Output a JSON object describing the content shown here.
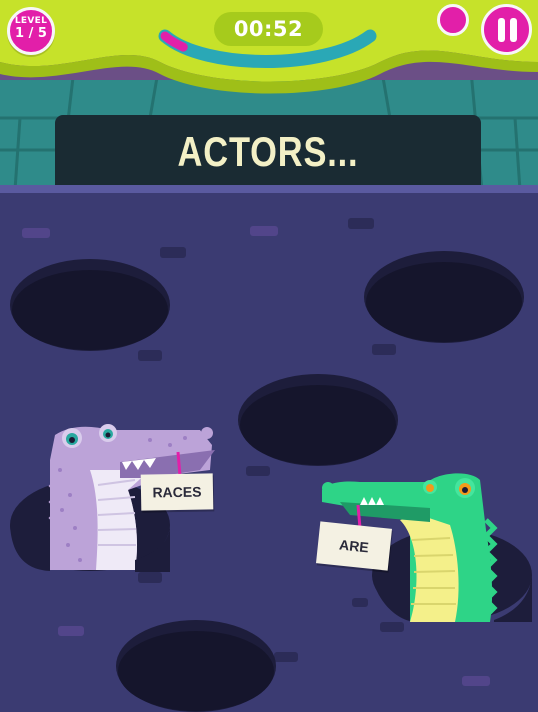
{
  "level": {
    "label": "LEVEL",
    "value": "1 / 5"
  },
  "timer": {
    "value": "00:52",
    "progress": 0.1
  },
  "prompt": {
    "text": "ACTORS..."
  },
  "answers": [
    {
      "text": "RACES"
    },
    {
      "text": "ARE"
    }
  ],
  "icons": {
    "sound": "speaker-icon",
    "pause": "pause-icon"
  },
  "colors": {
    "accent": "#e21fa9",
    "lime": "#c6e22a",
    "bg": "#3b3b72"
  }
}
